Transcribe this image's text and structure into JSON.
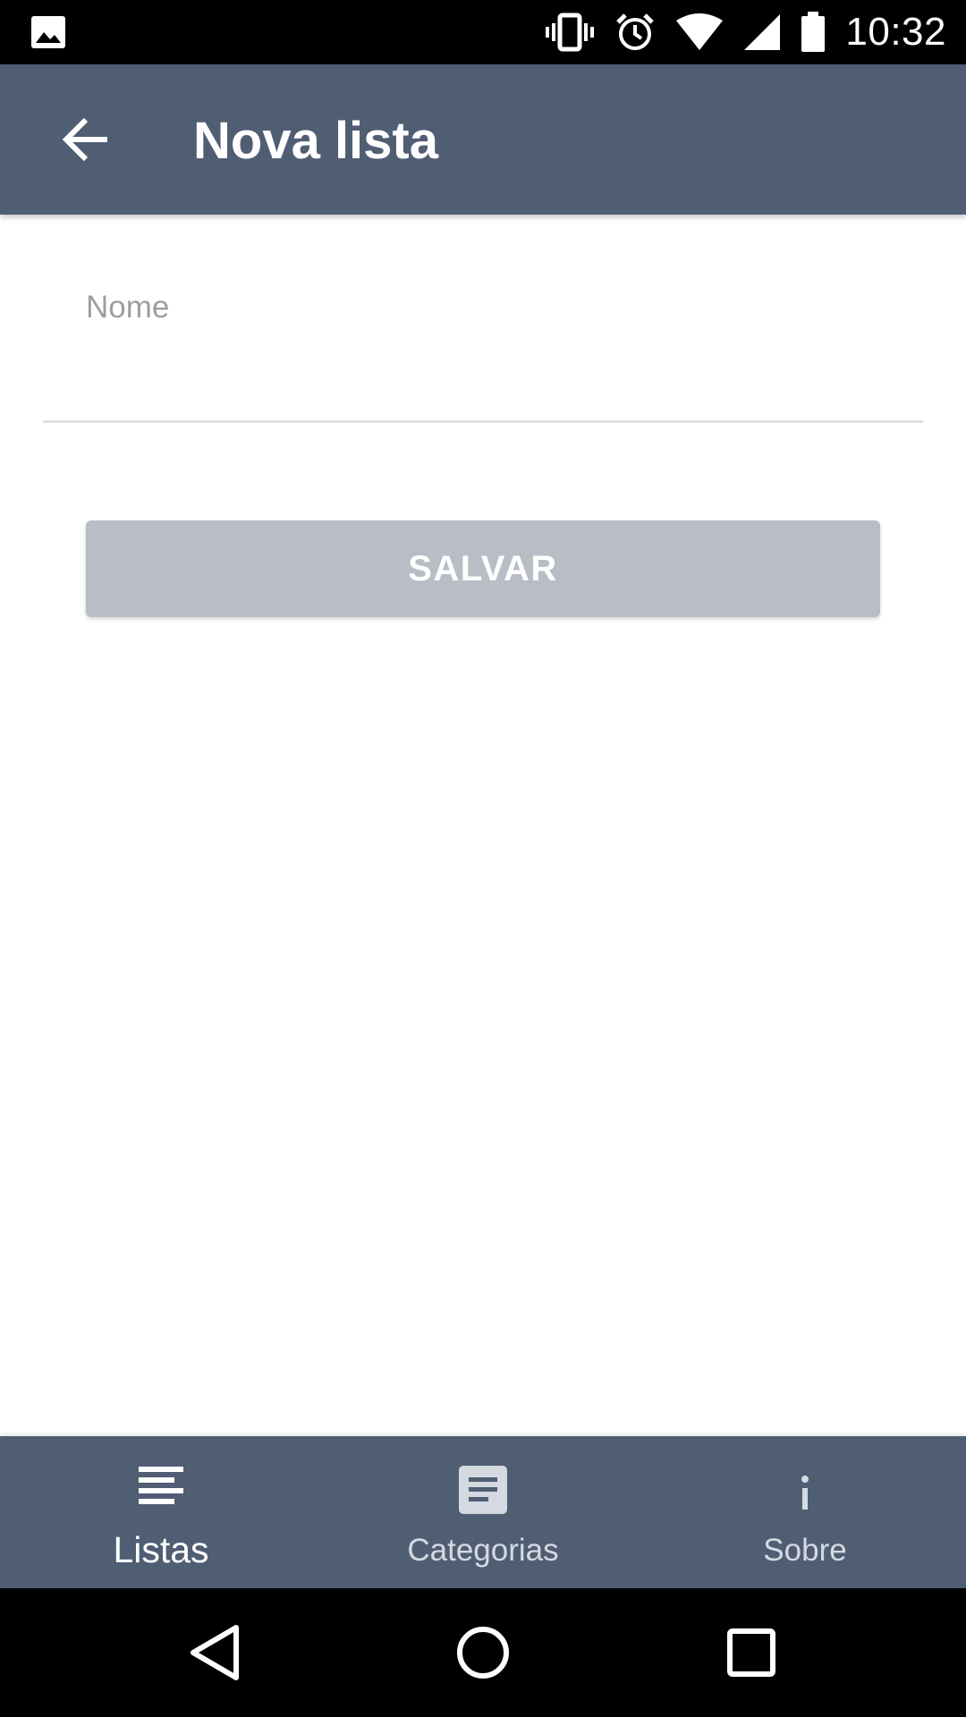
{
  "status_bar": {
    "time": "10:32",
    "icons": [
      "image-notification-icon",
      "vibrate-icon",
      "alarm-icon",
      "wifi-icon",
      "cellular-signal-icon",
      "battery-icon"
    ]
  },
  "app_bar": {
    "title": "Nova lista",
    "back_icon": "arrow-left-icon",
    "background_color": "#505e74"
  },
  "form": {
    "name_field": {
      "placeholder": "Nome",
      "value": ""
    },
    "save_button": {
      "label": "SALVAR",
      "color": "#b9bdc5",
      "enabled": false
    }
  },
  "bottom_nav": {
    "background_color": "#505e74",
    "items": [
      {
        "label": "Listas",
        "icon": "list-lines-icon",
        "active": true
      },
      {
        "label": "Categorias",
        "icon": "document-icon",
        "active": false
      },
      {
        "label": "Sobre",
        "icon": "info-icon",
        "active": false
      }
    ]
  },
  "system_nav": {
    "buttons": [
      "back-triangle-icon",
      "home-circle-icon",
      "recents-square-icon"
    ]
  }
}
